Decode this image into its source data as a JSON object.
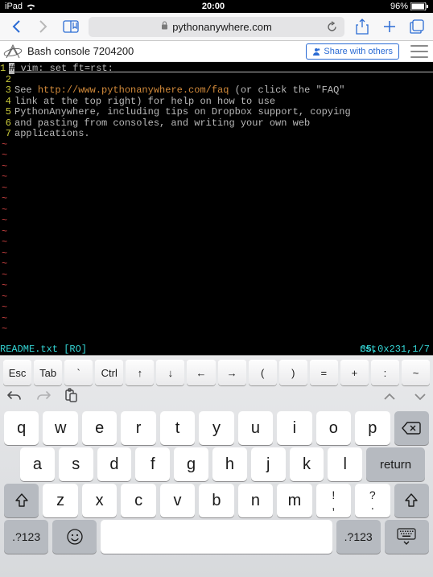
{
  "status": {
    "carrier": "iPad",
    "time": "20:00",
    "battery": "96%"
  },
  "safari": {
    "url": "pythonanywhere.com"
  },
  "app": {
    "title": "Bash console 7204200",
    "share": "Share with others"
  },
  "term": {
    "lines": [
      {
        "n": "1",
        "segs": [
          {
            "t": "# ",
            "c": "plain caret-prefix"
          },
          {
            "t": "vim: set ft=rst:",
            "c": "plain underline"
          }
        ]
      },
      {
        "n": "2",
        "segs": []
      },
      {
        "n": "3",
        "segs": [
          {
            "t": "See ",
            "c": "plain"
          },
          {
            "t": "http://www.pythonanywhere.com/faq",
            "c": "url"
          },
          {
            "t": " (or click the \"FAQ\"",
            "c": "plain"
          }
        ]
      },
      {
        "n": "4",
        "segs": [
          {
            "t": "link at the top right) for help on how to use",
            "c": "plain"
          }
        ]
      },
      {
        "n": "5",
        "segs": [
          {
            "t": "PythonAnywhere, including tips on Dropbox support, copying",
            "c": "plain"
          }
        ]
      },
      {
        "n": "6",
        "segs": [
          {
            "t": "and pasting from consoles, and writing your own web",
            "c": "plain"
          }
        ]
      },
      {
        "n": "7",
        "segs": [
          {
            "t": "applications.",
            "c": "plain"
          }
        ]
      }
    ],
    "status": {
      "file": "README.txt [RO]",
      "ft": "rst",
      "pos": "35,0x23",
      "pct": "1,1/7"
    }
  },
  "kb": {
    "specials": [
      "Esc",
      "Tab",
      "`",
      "Ctrl",
      "↑",
      "↓",
      "←",
      "→",
      "(",
      ")",
      "=",
      "+",
      ":",
      "~"
    ],
    "row1": [
      "q",
      "w",
      "e",
      "r",
      "t",
      "y",
      "u",
      "i",
      "o",
      "p"
    ],
    "row2": [
      "a",
      "s",
      "d",
      "f",
      "g",
      "h",
      "j",
      "k",
      "l"
    ],
    "return": "return",
    "row3": [
      "z",
      "x",
      "c",
      "v",
      "b",
      "n",
      "m"
    ],
    "punct": [
      {
        "top": "!",
        "bot": ","
      },
      {
        "top": "?",
        "bot": "."
      }
    ],
    "numkey": ".?123"
  }
}
